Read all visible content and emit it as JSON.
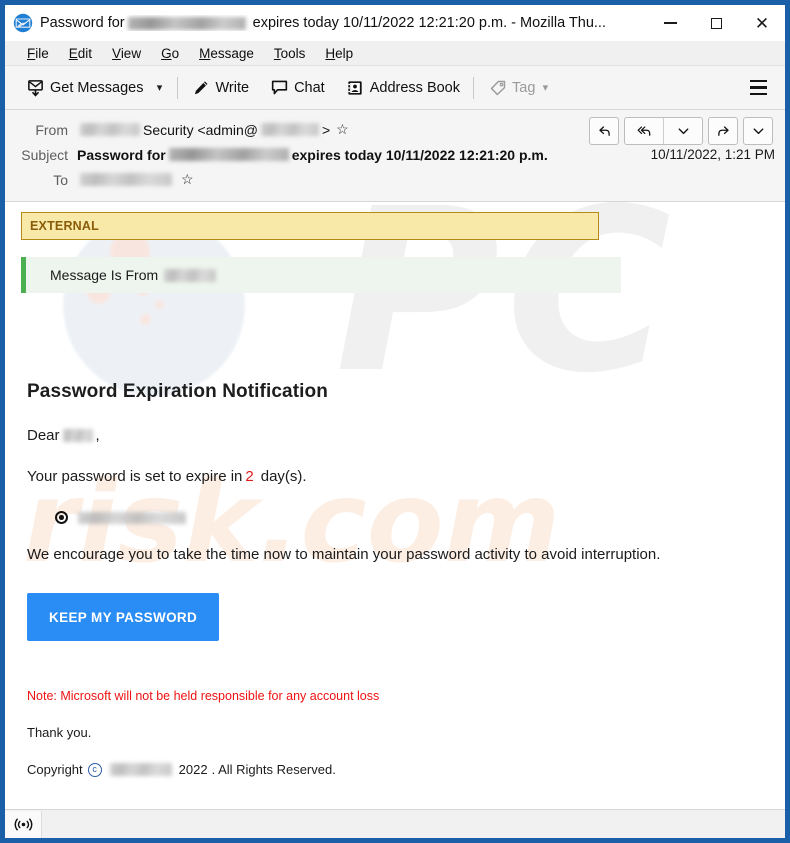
{
  "window": {
    "title": "Password for [redacted] expires today 10/11/2022 12:21:20 p.m. - Mozilla Thu...",
    "title_prefix": "Password for",
    "title_suffix": "expires today 10/11/2022 12:21:20 p.m. - Mozilla Thu...",
    "app_icon": "thunderbird-icon",
    "controls": {
      "minimize": "minimize-icon",
      "maximize": "maximize-icon",
      "close": "close-icon"
    },
    "border_color": "#1a5fa8"
  },
  "menubar": {
    "items": [
      {
        "label": "File",
        "accesskey": "F"
      },
      {
        "label": "Edit",
        "accesskey": "E"
      },
      {
        "label": "View",
        "accesskey": "V"
      },
      {
        "label": "Go",
        "accesskey": "G"
      },
      {
        "label": "Message",
        "accesskey": "M"
      },
      {
        "label": "Tools",
        "accesskey": "T"
      },
      {
        "label": "Help",
        "accesskey": "H"
      }
    ]
  },
  "toolbar": {
    "get_messages": "Get Messages",
    "get_messages_icon": "get-messages-icon",
    "get_messages_chevron": "chevron-down-icon",
    "write": "Write",
    "write_icon": "pencil-icon",
    "chat": "Chat",
    "chat_icon": "speech-bubble-icon",
    "address_book": "Address Book",
    "address_book_icon": "address-card-icon",
    "tag": "Tag",
    "tag_icon": "tag-icon",
    "tag_chevron": "chevron-down-icon",
    "tag_disabled": true,
    "app_menu_icon": "hamburger-menu-icon"
  },
  "message_header": {
    "from_label": "From",
    "from_value_prefix": "",
    "from_value_mid": "Security <admin@",
    "from_value_suffix": ">",
    "from_star_icon": "star-icon",
    "subject_label": "Subject",
    "subject_prefix": "Password for",
    "subject_suffix": "expires today 10/11/2022 12:21:20 p.m.",
    "to_label": "To",
    "to_star_icon": "star-icon",
    "date": "10/11/2022, 1:21 PM",
    "actions": {
      "reply": "reply-icon",
      "reply_all": "reply-all-icon",
      "reply_all_chevron": "chevron-down-icon",
      "forward": "forward-icon",
      "more_chevron": "chevron-down-icon"
    }
  },
  "body": {
    "external_banner": {
      "label": "EXTERNAL",
      "background": "#f8e9a8",
      "border": "#b58a16",
      "text_color": "#8a5c0a"
    },
    "message_from_bar": {
      "text": "Message Is From",
      "accent_color": "#4caf50",
      "background": "#eef5ee"
    },
    "heading": "Password Expiration Notification",
    "salutation_prefix": "Dear",
    "salutation_suffix": ",",
    "expire_prefix": "Your password is set to expire in",
    "expire_days": "2",
    "expire_suffix": "day(s).",
    "expire_days_color": "#e01b1b",
    "bullet_icon": "radio-bullet-icon",
    "encourage_text": "We encourage you to take the time now to maintain your password activity to avoid interruption.",
    "cta_label": "KEEP MY PASSWORD",
    "cta_color": "#2a8cf5",
    "note": "Note: Microsoft will not be held responsible for any account loss",
    "note_color": "#ef1212",
    "thank_you": "Thank you.",
    "copyright_prefix": "Copyright",
    "copyright_symbol": "c",
    "copyright_year": "2022",
    "copyright_suffix": ". All Rights Reserved."
  },
  "statusbar": {
    "indicator_icon": "broadcast-icon"
  }
}
